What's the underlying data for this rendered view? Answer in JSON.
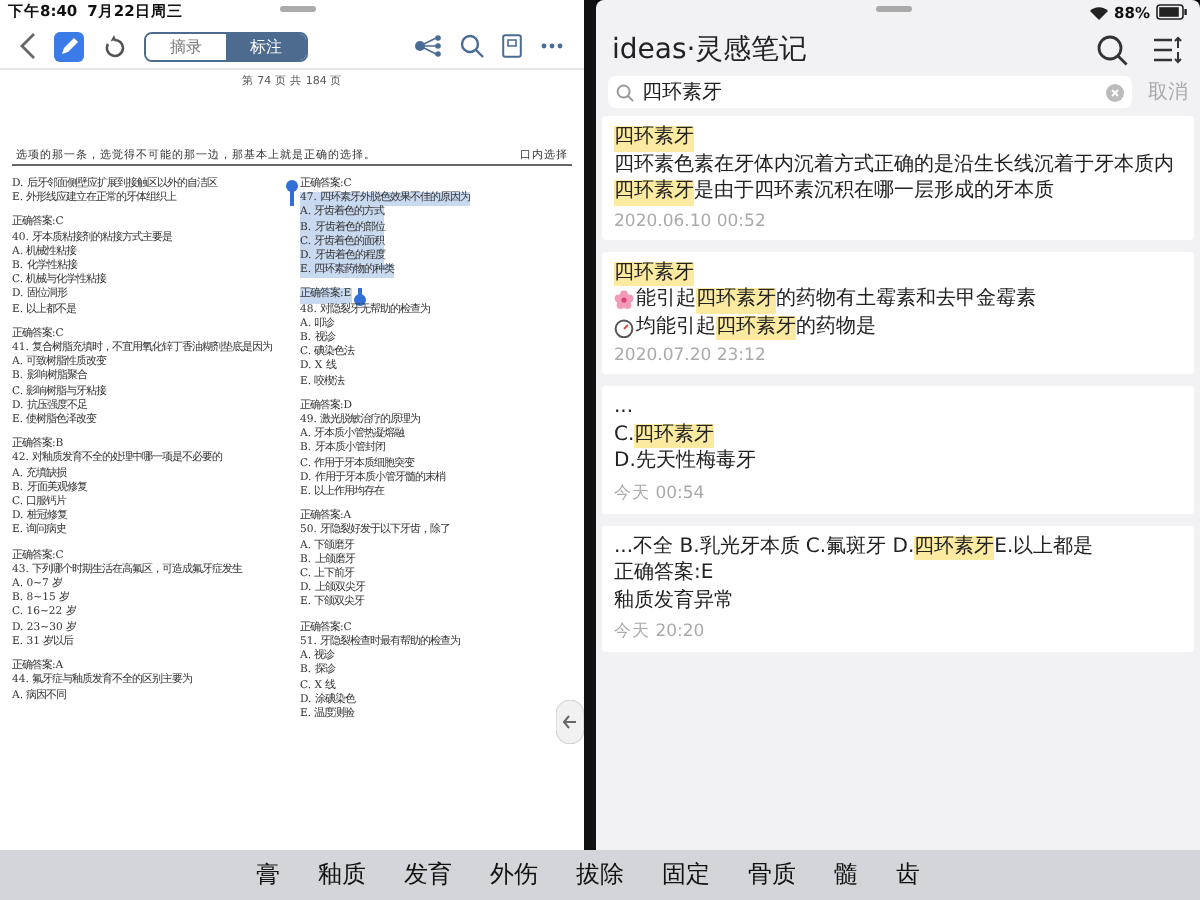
{
  "status_bar": {
    "time": "下午8:40",
    "date": "7月22日周三",
    "battery": "88%"
  },
  "reader": {
    "pen_selected": true,
    "segments": [
      {
        "label": "摘录",
        "selected": false
      },
      {
        "label": "标注",
        "selected": true
      }
    ],
    "page_label": "第 74 页 共 184 页",
    "header_text": "选项的那一条，选觉得不可能的那一边，那基本上就是正确的选择。",
    "header_section": "口内选择",
    "columns": [
      [
        {
          "lines": [
            {
              "text": "D. 后牙邻面侧壁应扩展到接触区以外的自洁区",
              "highlighted": false
            },
            {
              "text": "E. 外形线应建立在正常的牙体组织上",
              "highlighted": false
            }
          ]
        },
        {
          "lines": [
            {
              "text": "正确答案:C",
              "highlighted": false
            },
            {
              "text": "40. 牙本质粘接剂的粘接方式主要是",
              "highlighted": false
            },
            {
              "text": "A. 机械性粘接",
              "highlighted": false
            },
            {
              "text": "B. 化学性粘接",
              "highlighted": false
            },
            {
              "text": "C. 机械与化学性粘接",
              "highlighted": false
            },
            {
              "text": "D. 固位洞形",
              "highlighted": false
            },
            {
              "text": "E. 以上都不是",
              "highlighted": false
            }
          ]
        },
        {
          "lines": [
            {
              "text": "正确答案:C",
              "highlighted": false
            },
            {
              "text": "41. 复合树脂充填时，不宜用氧化锌丁香油糊剂垫底是因为",
              "highlighted": false
            },
            {
              "text": "A. 可致树脂性质改变",
              "highlighted": false
            },
            {
              "text": "B. 影响树脂聚合",
              "highlighted": false
            },
            {
              "text": "C. 影响树脂与牙粘接",
              "highlighted": false
            },
            {
              "text": "D. 抗压强度不足",
              "highlighted": false
            },
            {
              "text": "E. 使树脂色泽改变",
              "highlighted": false
            }
          ]
        },
        {
          "lines": [
            {
              "text": "正确答案:B",
              "highlighted": false
            },
            {
              "text": "42. 对釉质发育不全的处理中哪一项是不必要的",
              "highlighted": false
            },
            {
              "text": "A. 充填缺损",
              "highlighted": false
            },
            {
              "text": "B. 牙面美观修复",
              "highlighted": false
            },
            {
              "text": "C. 口服钙片",
              "highlighted": false
            },
            {
              "text": "D. 桩冠修复",
              "highlighted": false
            },
            {
              "text": "E. 询问病史",
              "highlighted": false
            }
          ]
        },
        {
          "lines": [
            {
              "text": "正确答案:C",
              "highlighted": false
            },
            {
              "text": "43. 下列哪个时期生活在高氟区，可造成氟牙症发生",
              "highlighted": false
            },
            {
              "text": "A. 0~7 岁",
              "highlighted": false
            },
            {
              "text": "B. 8~15 岁",
              "highlighted": false
            },
            {
              "text": "C. 16~22 岁",
              "highlighted": false
            },
            {
              "text": "D. 23~30 岁",
              "highlighted": false
            },
            {
              "text": "E. 31 岁以后",
              "highlighted": false
            }
          ]
        },
        {
          "lines": [
            {
              "text": "正确答案:A",
              "highlighted": false
            },
            {
              "text": "44. 氟牙症与釉质发育不全的区别主要为",
              "highlighted": false
            },
            {
              "text": "A. 病因不同",
              "highlighted": false
            }
          ]
        }
      ],
      [
        {
          "lines": [
            {
              "text": "正确答案:C",
              "highlighted": false
            },
            {
              "text": "47. 四环素牙外脱色效果不佳的原因为",
              "highlighted": true
            },
            {
              "text": "A. 牙齿着色的方式",
              "highlighted": true
            },
            {
              "text": "B. 牙齿着色的部位",
              "highlighted": true
            },
            {
              "text": "C. 牙齿着色的面积",
              "highlighted": true
            },
            {
              "text": "D. 牙齿着色的程度",
              "highlighted": true
            },
            {
              "text": "E. 四环素药物的种类",
              "highlighted": true
            }
          ]
        },
        {
          "lines": [
            {
              "text": "正确答案:E",
              "highlighted": true
            },
            {
              "text": "48. 对隐裂牙无帮助的检查为",
              "highlighted": false
            },
            {
              "text": "A. 叩诊",
              "highlighted": false
            },
            {
              "text": "B. 视诊",
              "highlighted": false
            },
            {
              "text": "C. 碘染色法",
              "highlighted": false
            },
            {
              "text": "D. X 线",
              "highlighted": false
            },
            {
              "text": "E. 咬楔法",
              "highlighted": false
            }
          ]
        },
        {
          "lines": [
            {
              "text": "正确答案:D",
              "highlighted": false
            },
            {
              "text": "49. 激光脱敏治疗的原理为",
              "highlighted": false
            },
            {
              "text": "A. 牙本质小管热凝熔融",
              "highlighted": false
            },
            {
              "text": "B. 牙本质小管封闭",
              "highlighted": false
            },
            {
              "text": "C. 作用于牙本质细胞突变",
              "highlighted": false
            },
            {
              "text": "D. 作用于牙本质小管牙髓的末梢",
              "highlighted": false
            },
            {
              "text": "E. 以上作用均存在",
              "highlighted": false
            }
          ]
        },
        {
          "lines": [
            {
              "text": "正确答案:A",
              "highlighted": false
            },
            {
              "text": "50. 牙隐裂好发于以下牙齿，除了",
              "highlighted": false
            },
            {
              "text": "A. 下颌磨牙",
              "highlighted": false
            },
            {
              "text": "B. 上颌磨牙",
              "highlighted": false
            },
            {
              "text": "C. 上下前牙",
              "highlighted": false
            },
            {
              "text": "D. 上颌双尖牙",
              "highlighted": false
            },
            {
              "text": "E. 下颌双尖牙",
              "highlighted": false
            }
          ]
        },
        {
          "lines": [
            {
              "text": "正确答案:C",
              "highlighted": false
            },
            {
              "text": "51. 牙隐裂检查时最有帮助的检查为",
              "highlighted": false
            },
            {
              "text": "A. 视诊",
              "highlighted": false
            },
            {
              "text": "B. 探诊",
              "highlighted": false
            },
            {
              "text": "C. X 线",
              "highlighted": false
            },
            {
              "text": "D. 涂碘染色",
              "highlighted": false
            },
            {
              "text": "E. 温度测验",
              "highlighted": false
            }
          ]
        }
      ]
    ]
  },
  "notes": {
    "title": "ideas·灵感笔记",
    "search": {
      "value": "四环素牙"
    },
    "cancel": "取消",
    "cards": [
      {
        "lines": [
          {
            "segments": [
              {
                "text": "四环素牙",
                "highlighted": true
              }
            ]
          },
          {
            "segments": [
              {
                "text": "四环素色素在牙体内沉着方式正确的是沿生长线沉着于牙本质内",
                "highlighted": false
              }
            ]
          },
          {
            "segments": [
              {
                "text": "四环素牙",
                "highlighted": true
              },
              {
                "text": "是由于四环素沉积在哪一层形成的牙本质",
                "highlighted": false
              }
            ]
          }
        ],
        "time": "2020.06.10 00:52"
      },
      {
        "lines": [
          {
            "segments": [
              {
                "text": "四环素牙",
                "highlighted": true
              }
            ]
          },
          {
            "kind": "flower-bullet",
            "segments": [
              {
                "text": "能引起",
                "highlighted": false
              },
              {
                "text": "四环素牙",
                "highlighted": true
              },
              {
                "text": "的药物有土霉素和去甲金霉素",
                "highlighted": false
              }
            ]
          },
          {
            "kind": "clock-bullet",
            "segments": [
              {
                "text": "均能引起",
                "highlighted": false
              },
              {
                "text": "四环素牙",
                "highlighted": true
              },
              {
                "text": "的药物是",
                "highlighted": false
              }
            ]
          }
        ],
        "time": "2020.07.20 23:12"
      },
      {
        "lines": [
          {
            "segments": [
              {
                "text": "...",
                "highlighted": false
              }
            ]
          },
          {
            "segments": [
              {
                "text": "C.",
                "highlighted": false
              },
              {
                "text": "四环素牙",
                "highlighted": true
              }
            ]
          },
          {
            "segments": [
              {
                "text": "D.先天性梅毒牙",
                "highlighted": false
              }
            ]
          }
        ],
        "time": "今天 00:54"
      },
      {
        "lines": [
          {
            "segments": [
              {
                "text": "...不全 B.乳光牙本质 C.氟斑牙 D.",
                "highlighted": false
              },
              {
                "text": "四环素牙",
                "highlighted": true
              },
              {
                "text": " E.以上都是",
                "highlighted": false
              }
            ]
          },
          {
            "segments": [
              {
                "text": "正确答案:E",
                "highlighted": false
              }
            ]
          },
          {
            "segments": [
              {
                "text": "釉质发育异常",
                "highlighted": false
              }
            ]
          }
        ],
        "time": "今天 20:20"
      }
    ]
  },
  "candidates": [
    "膏",
    "釉质",
    "发育",
    "外伤",
    "拔除",
    "固定",
    "骨质",
    "髓",
    "齿"
  ]
}
